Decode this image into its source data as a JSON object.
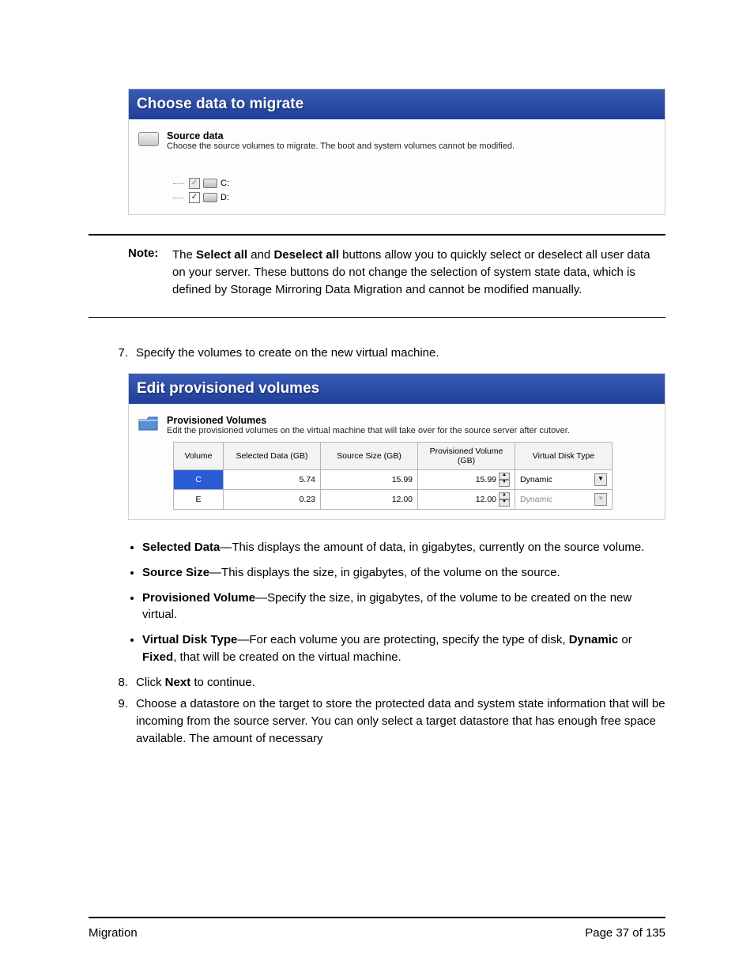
{
  "panel1": {
    "title": "Choose data to migrate",
    "section_title": "Source data",
    "section_desc": "Choose the source volumes to migrate.  The boot and system volumes cannot be modified.",
    "volumes": [
      {
        "label": "C:",
        "checked": true,
        "enabled": false
      },
      {
        "label": "D:",
        "checked": true,
        "enabled": true
      }
    ]
  },
  "note": {
    "label": "Note:",
    "prefix": "The ",
    "b1": "Select all",
    "mid1": " and ",
    "b2": "Deselect all",
    "rest": " buttons allow you to quickly select or deselect all user data on your server. These buttons do not change the selection of system state data, which is defined by Storage Mirroring Data Migration and cannot be modified manually."
  },
  "step7": {
    "num": "7.",
    "text": "Specify the volumes to create on the new virtual machine."
  },
  "panel2": {
    "title": "Edit provisioned volumes",
    "section_title": "Provisioned Volumes",
    "section_desc": "Edit the provisioned volumes on the virtual machine that will take over for the source server after cutover.",
    "headers": {
      "vol": "Volume",
      "sel": "Selected Data (GB)",
      "src": "Source Size (GB)",
      "prov": "Provisioned Volume (GB)",
      "vdt": "Virtual Disk Type"
    },
    "rows": [
      {
        "vol": "C",
        "sel": "5.74",
        "src": "15.99",
        "prov": "15.99",
        "vdt": "Dynamic",
        "selected_row": true,
        "vdt_enabled": true
      },
      {
        "vol": "E",
        "sel": "0.23",
        "src": "12.00",
        "prov": "12.00",
        "vdt": "Dynamic",
        "selected_row": false,
        "vdt_enabled": false
      }
    ]
  },
  "defs": {
    "d1_label": "Selected Data",
    "d1_text": "—This displays the amount of data, in gigabytes, currently on the source volume.",
    "d2_label": "Source Size",
    "d2_text": "—This displays the size, in gigabytes, of the volume on the source.",
    "d3_label": "Provisioned Volume",
    "d3_text": "—Specify the size, in gigabytes, of the volume to be created on the new virtual.",
    "d4_label": "Virtual Disk Type",
    "d4_pre": "—For each volume you are protecting, specify the type of disk, ",
    "d4_b1": "Dynamic",
    "d4_mid": " or ",
    "d4_b2": "Fixed",
    "d4_post": ", that will be created on the virtual machine."
  },
  "step8": {
    "num": "8.",
    "pre": "Click ",
    "b": "Next",
    "post": " to continue."
  },
  "step9": {
    "num": "9.",
    "text": "Choose a datastore on the target to store the protected data and system state information that will be incoming from the source server. You can only select a target datastore that has enough free space available. The amount of necessary"
  },
  "footer": {
    "left": "Migration",
    "right": "Page 37 of 135"
  }
}
